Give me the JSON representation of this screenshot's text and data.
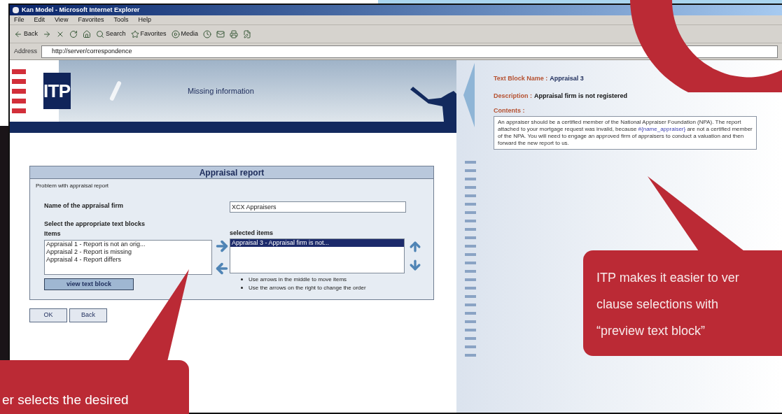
{
  "browser": {
    "title": "Kan Model - Microsoft Internet Explorer",
    "menu": [
      "File",
      "Edit",
      "View",
      "Favorites",
      "Tools",
      "Help"
    ],
    "toolbar": [
      {
        "kind": "back",
        "label": "Back"
      },
      {
        "kind": "forward"
      },
      {
        "kind": "stop"
      },
      {
        "kind": "refresh"
      },
      {
        "kind": "home"
      },
      {
        "kind": "search",
        "label": "Search"
      },
      {
        "kind": "favorites",
        "label": "Favorites"
      },
      {
        "kind": "media",
        "label": "Media"
      },
      {
        "kind": "history"
      },
      {
        "kind": "mail"
      },
      {
        "kind": "print"
      },
      {
        "kind": "edit"
      }
    ],
    "address": {
      "label": "Address",
      "value": "http://server/correspondence"
    }
  },
  "page": {
    "header": {
      "logo": "ITP",
      "title": "Missing information"
    },
    "form": {
      "title": "Appraisal report",
      "subtitle": "Problem with appraisal report",
      "firm_label": "Name of the appraisal firm",
      "firm_value": "XCX Appraisers",
      "blocks_label": "Select the appropriate text blocks",
      "items_label": "Items",
      "items": [
        {
          "text": "Appraisal 1 - Report is not an orig...",
          "selected": false
        },
        {
          "text": "Appraisal 2 - Report is missing",
          "selected": false
        },
        {
          "text": "Appraisal 4 - Report differs",
          "selected": false
        }
      ],
      "selected_label": "selected items",
      "selected_items": [
        {
          "text": "Appraisal 3 - Appraisal firm is not...",
          "selected": true
        }
      ],
      "view_button": "view text block",
      "hints": [
        "Use arrows in the middle to move items",
        "Use the arrows on the right to change the order"
      ]
    },
    "buttons": [
      "OK",
      "Back"
    ]
  },
  "preview": {
    "name_label": "Text Block Name :",
    "name_value": "Appraisal 3",
    "description_label": "Description :",
    "description_value": "Appraisal firm is not registered",
    "contents_label": "Contents :",
    "contents": {
      "before": "An appraiser should be a certified member of the National Appraiser Foundation (NPA). The report attached to your mortgage request was invalid, because ",
      "field": "#{name_appraiser}",
      "after": " are not a certified member of the NPA. You will need to engage an approved firm of appraisers to conduct a valuation and then forward the new report to us."
    }
  },
  "callouts": [
    {
      "lines": [
        "er selects the desired"
      ]
    },
    {
      "lines": [
        "ITP makes it easier to ver",
        "clause selections with",
        "“preview text block”"
      ]
    }
  ]
}
